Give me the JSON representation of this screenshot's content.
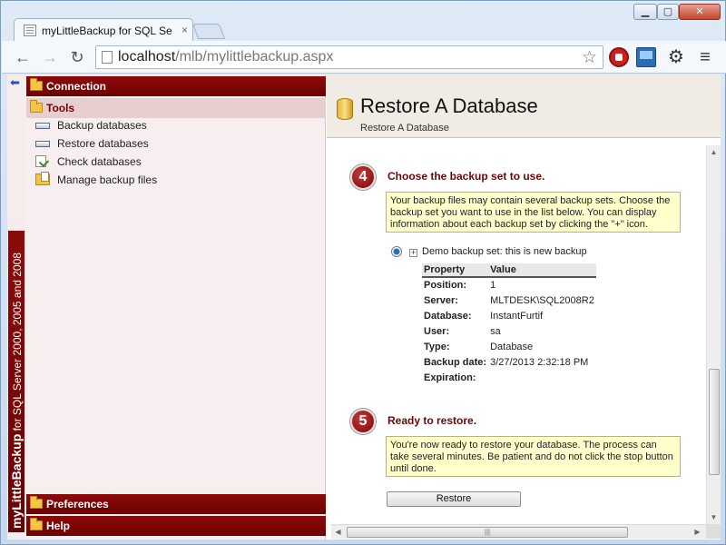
{
  "browser": {
    "tab_title": "myLittleBackup for SQL Se",
    "tab_close": "×",
    "url_host": "localhost",
    "url_path": "/mlb/mylittlebackup.aspx",
    "window_buttons": {
      "min": "▁",
      "max": "▢",
      "close": "✕"
    },
    "icons": [
      "back-icon",
      "forward-icon",
      "reload-icon",
      "star-icon",
      "stop-extension-icon",
      "remote-extension-icon",
      "gear-icon",
      "menu-icon"
    ]
  },
  "sidebar": {
    "vertical_brand": "myLittleBackup",
    "vertical_text": " for SQL Server 2000, 2005 and 2008",
    "sections": {
      "connection": "Connection",
      "tools": "Tools",
      "preferences": "Preferences",
      "help": "Help"
    },
    "tools_items": [
      {
        "label": "Backup databases",
        "icon": "database-icon"
      },
      {
        "label": "Restore databases",
        "icon": "database-restore-icon"
      },
      {
        "label": "Check databases",
        "icon": "check-document-icon"
      },
      {
        "label": "Manage backup files",
        "icon": "folder-files-icon"
      }
    ]
  },
  "main": {
    "title": "Restore A Database",
    "breadcrumb": "Restore A Database",
    "step4": {
      "number": "4",
      "title": "Choose the backup set to use.",
      "note": "Your backup files may contain several backup sets. Choose the backup set you want to use in the list below. You can display information about each backup set by clicking the \"+\" icon."
    },
    "backup_set": {
      "expand_symbol": "+",
      "label": "Demo backup set: this is new backup",
      "headers": {
        "property": "Property",
        "value": "Value"
      },
      "rows": [
        {
          "k": "Position:",
          "v": "1"
        },
        {
          "k": "Server:",
          "v": "MLTDESK\\SQL2008R2"
        },
        {
          "k": "Database:",
          "v": "InstantFurtif"
        },
        {
          "k": "User:",
          "v": "sa"
        },
        {
          "k": "Type:",
          "v": "Database"
        },
        {
          "k": "Backup date:",
          "v": "3/27/2013 2:32:18 PM"
        },
        {
          "k": "Expiration:",
          "v": ""
        }
      ]
    },
    "step5": {
      "number": "5",
      "title": "Ready to restore.",
      "note": "You're now ready to restore your database. The process can take several minutes. Be patient and do not click the stop button until done."
    },
    "restore_button": "Restore"
  },
  "colors": {
    "accent": "#7a0404",
    "note_bg": "#ffffcc",
    "chrome": "#c7d9ef"
  }
}
